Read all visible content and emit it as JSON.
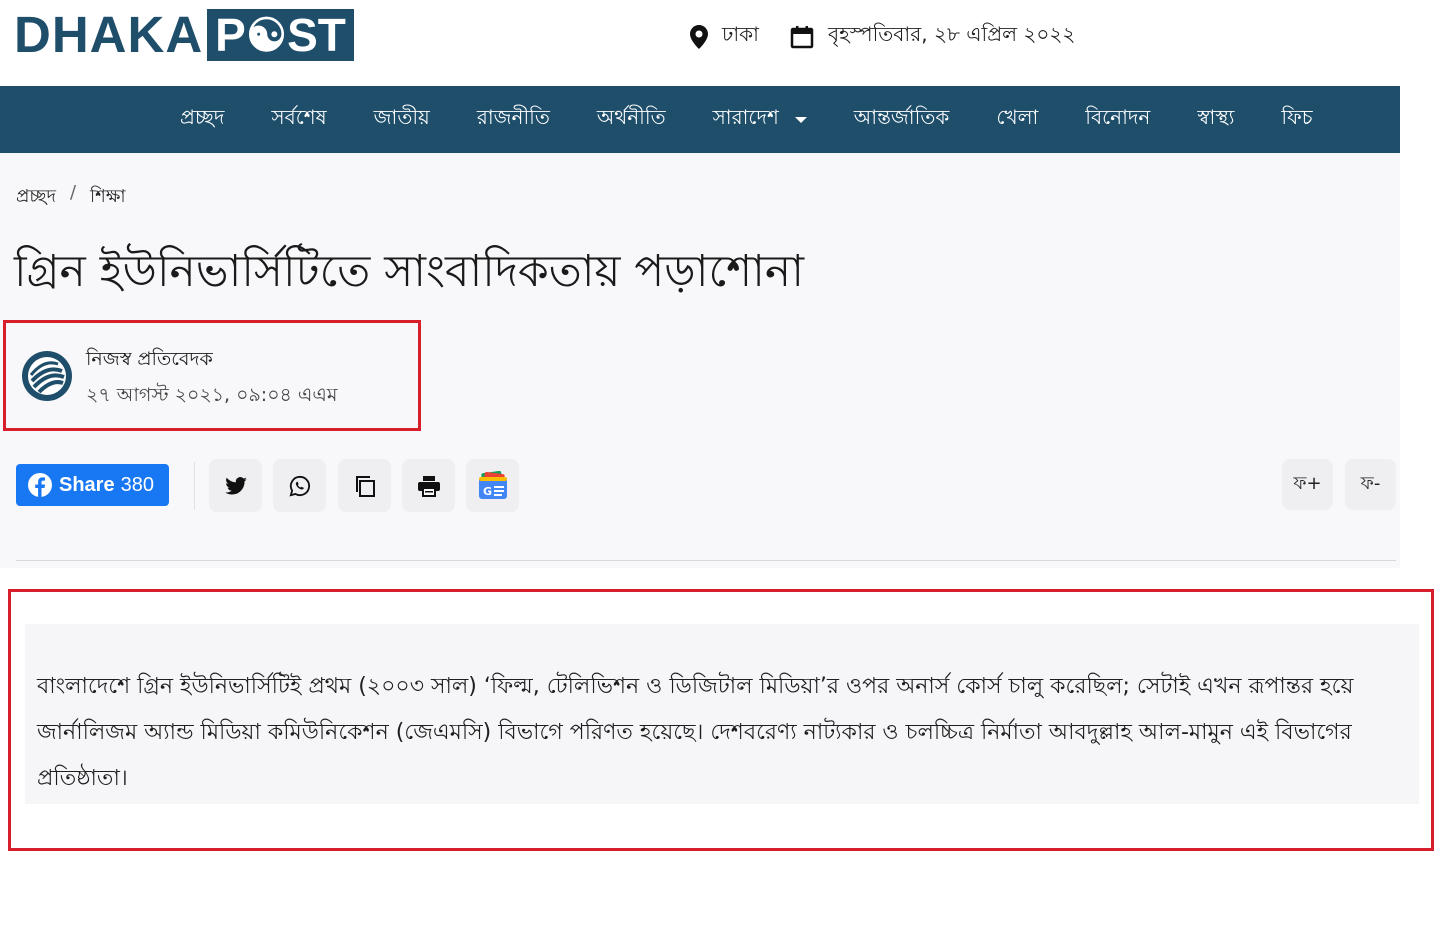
{
  "header": {
    "logo_left": "DHAKA",
    "logo_right": "P☯ST",
    "location": "ঢাকা",
    "date": "বৃহস্পতিবার, ২৮ এপ্রিল ২০২২"
  },
  "nav": {
    "items": [
      {
        "label": "প্রচ্ছদ"
      },
      {
        "label": "সর্বশেষ"
      },
      {
        "label": "জাতীয়"
      },
      {
        "label": "রাজনীতি"
      },
      {
        "label": "অর্থনীতি"
      },
      {
        "label": "সারাদেশ",
        "has_dropdown": true
      },
      {
        "label": "আন্তর্জাতিক"
      },
      {
        "label": "খেলা"
      },
      {
        "label": "বিনোদন"
      },
      {
        "label": "স্বাস্থ্য"
      },
      {
        "label": "ফিচ"
      }
    ]
  },
  "breadcrumb": {
    "home": "প্রচ্ছদ",
    "separator": "/",
    "current": "শিক্ষা"
  },
  "article": {
    "title": "গ্রিন ইউনিভার্সিটিতে সাংবাদিকতায় পড়াশোনা",
    "author": "নিজস্ব প্রতিবেদক",
    "published": "২৭ আগস্ট ২০২১, ০৯:০৪ এএম",
    "body": "বাংলাদেশে গ্রিন ইউনিভার্সিটিই প্রথম (২০০৩ সাল) ‘ফিল্ম, টেলিভিশন ও ডিজিটাল মিডিয়া’র ওপর অনার্স কোর্স চালু করেছিল; সেটাই এখন রূপান্তর হয়ে জার্নালিজম অ্যান্ড মিডিয়া কমিউনিকেশন (জেএমসি) বিভাগে পরিণত হয়েছে। দেশবরেণ্য নাট্যকার ও চলচ্চিত্র নির্মাতা আবদুল্লাহ আল-মামুন এই বিভাগের প্রতিষ্ঠাতা।"
  },
  "share": {
    "facebook_label": "Share",
    "facebook_count": "380",
    "font_increase": "ফ+",
    "font_decrease": "ফ-"
  },
  "colors": {
    "brand": "#1f4e6b",
    "facebook": "#1877f2",
    "highlight_border": "#d71f2b"
  },
  "icons": [
    "location-pin-icon",
    "calendar-icon",
    "facebook-icon",
    "twitter-icon",
    "whatsapp-icon",
    "copy-icon",
    "print-icon",
    "google-news-icon"
  ]
}
